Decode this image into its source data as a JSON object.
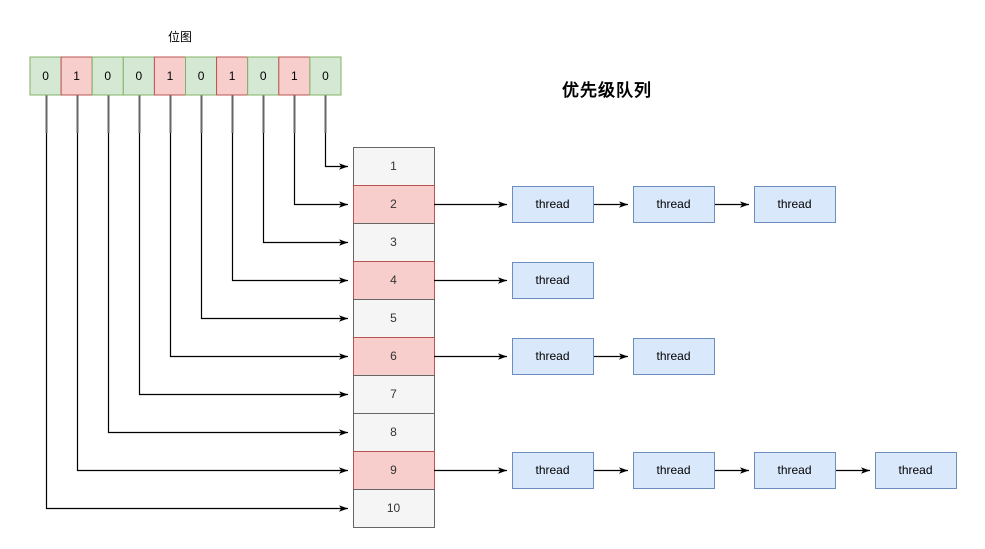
{
  "diagram": {
    "bitmap_label": "位图",
    "priority_queue_title": "优先级队列",
    "bitmap": {
      "cells": [
        {
          "value": "0",
          "set": false
        },
        {
          "value": "1",
          "set": true
        },
        {
          "value": "0",
          "set": false
        },
        {
          "value": "0",
          "set": false
        },
        {
          "value": "1",
          "set": true
        },
        {
          "value": "0",
          "set": false
        },
        {
          "value": "1",
          "set": true
        },
        {
          "value": "0",
          "set": false
        },
        {
          "value": "1",
          "set": true
        },
        {
          "value": "0",
          "set": false
        }
      ]
    },
    "queue": {
      "rows": [
        {
          "label": "1",
          "active": false,
          "threads": []
        },
        {
          "label": "2",
          "active": true,
          "threads": [
            "thread",
            "thread",
            "thread"
          ]
        },
        {
          "label": "3",
          "active": false,
          "threads": []
        },
        {
          "label": "4",
          "active": true,
          "threads": [
            "thread"
          ]
        },
        {
          "label": "5",
          "active": false,
          "threads": []
        },
        {
          "label": "6",
          "active": true,
          "threads": [
            "thread",
            "thread"
          ]
        },
        {
          "label": "7",
          "active": false,
          "threads": []
        },
        {
          "label": "8",
          "active": false,
          "threads": []
        },
        {
          "label": "9",
          "active": true,
          "threads": [
            "thread",
            "thread",
            "thread",
            "thread"
          ]
        },
        {
          "label": "10",
          "active": false,
          "threads": []
        }
      ]
    },
    "colors": {
      "bitmap_zero_fill": "#d5e8d4",
      "bitmap_zero_stroke": "#82b366",
      "bitmap_one_fill": "#f8cecc",
      "bitmap_one_stroke": "#b85450",
      "queue_idle_fill": "#f5f5f5",
      "queue_idle_stroke": "#666666",
      "queue_active_fill": "#f8cecc",
      "queue_active_stroke": "#b85450",
      "thread_fill": "#dae8fc",
      "thread_stroke": "#6c8ebf",
      "connector": "#000000",
      "stub": "#666666",
      "text": "#000000"
    }
  }
}
